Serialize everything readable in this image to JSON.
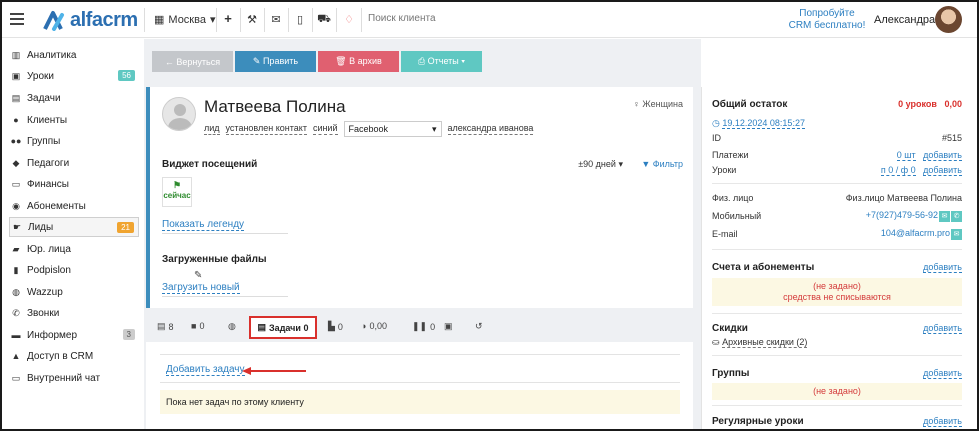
{
  "header": {
    "logo_text": "alfacrm",
    "branch": "Москва",
    "search_placeholder": "Поиск клиента",
    "promo_line1": "Попробуйте",
    "promo_line2": "CRM бесплатно!",
    "user_name": "Александра"
  },
  "sidebar": {
    "items": [
      {
        "label": "Аналитика",
        "icon": "chart-icon"
      },
      {
        "label": "Уроки",
        "icon": "calendar-icon",
        "badge": "56"
      },
      {
        "label": "Задачи",
        "icon": "tasks-icon"
      },
      {
        "label": "Клиенты",
        "icon": "user-icon"
      },
      {
        "label": "Группы",
        "icon": "group-icon"
      },
      {
        "label": "Педагоги",
        "icon": "teacher-icon"
      },
      {
        "label": "Финансы",
        "icon": "money-icon"
      },
      {
        "label": "Абонементы",
        "icon": "subscription-icon"
      },
      {
        "label": "Лиды",
        "icon": "leads-icon",
        "badge": "21"
      },
      {
        "label": "Юр. лица",
        "icon": "briefcase-icon"
      },
      {
        "label": "Podpislon",
        "icon": "document-icon"
      },
      {
        "label": "Wazzup",
        "icon": "whatsapp-icon"
      },
      {
        "label": "Звонки",
        "icon": "phone-icon"
      },
      {
        "label": "Информер",
        "icon": "informer-icon",
        "badge": "3"
      },
      {
        "label": "Доступ в CRM",
        "icon": "lock-icon"
      },
      {
        "label": "Внутренний чат",
        "icon": "chat-icon"
      }
    ]
  },
  "actions": {
    "back": "← Вернуться",
    "edit": "✎ Править",
    "archive": "🗑 В архив",
    "reports": "⎙ Отчеты ▾"
  },
  "client": {
    "name": "Матвеева Полина",
    "gender": "Женщина",
    "tag_lead": "лид",
    "tag_status": "установлен контакт",
    "tag_color": "синий",
    "source": "Facebook",
    "manager": "александра иванова",
    "visits_title": "Виджет посещений",
    "period": "±90 дней",
    "filter": "Фильтр",
    "visit_now": "сейчас",
    "show_legend": "Показать легенду",
    "files_title": "Загруженные файлы",
    "upload_new": "Загрузить новый"
  },
  "tabs": {
    "comments": "8",
    "messages": "0",
    "tasks": "Задачи 0",
    "lessons": "0",
    "payments": "0,00",
    "pauses": "0"
  },
  "tasks": {
    "add_task": "Добавить задачу",
    "empty": "Пока нет задач по этому клиенту"
  },
  "summary": {
    "balance_title": "Общий остаток",
    "balance_lessons": "0 уроков",
    "balance_amount": "0,00",
    "date": "19.12.2024 08:15:27",
    "id_label": "ID",
    "id_value": "#515",
    "payments_label": "Платежи",
    "payments_value": "0 шт",
    "add": "добавить",
    "lessons_label": "Уроки",
    "lessons_value": "п 0 / ф 0",
    "person_label": "Физ. лицо",
    "person_value": "Физ.лицо Матвеева Полина",
    "mobile_label": "Мобильный",
    "mobile_value": "+7(927)479-56-92",
    "email_label": "E-mail",
    "email_value": "104@alfacrm.pro",
    "accounts_title": "Счета и абонементы",
    "not_set": "(не задано)",
    "no_charge": "средства не списываются",
    "discounts_title": "Скидки",
    "archive_discounts": "Архивные скидки (2)",
    "groups_title": "Группы",
    "regular_title": "Регулярные уроки"
  }
}
